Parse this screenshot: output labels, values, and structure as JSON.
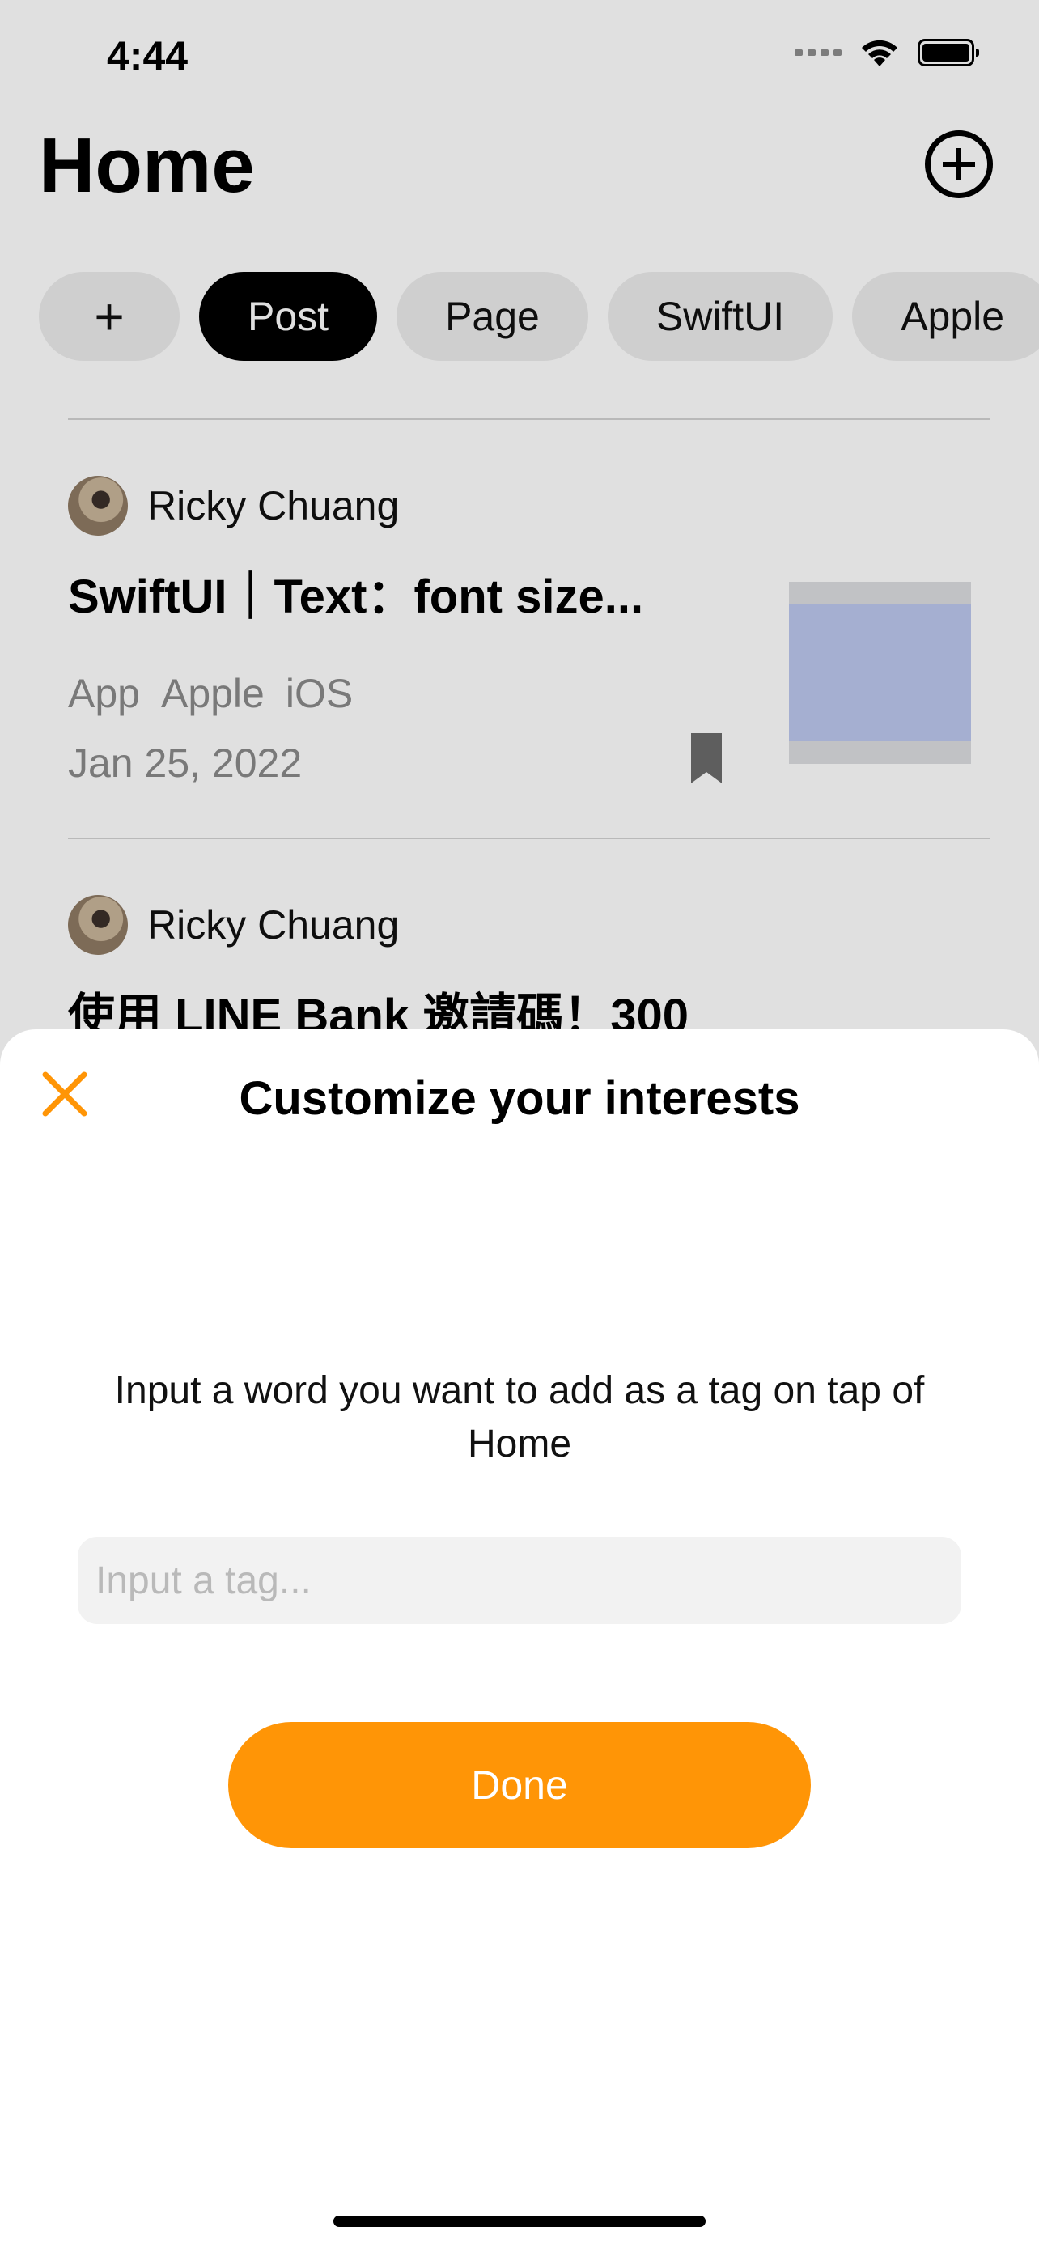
{
  "status_bar": {
    "time": "4:44"
  },
  "header": {
    "title": "Home",
    "add_icon": "plus-circle-icon"
  },
  "tags": {
    "add_label": "+",
    "items": [
      "Post",
      "Page",
      "SwiftUI",
      "Apple"
    ],
    "active": "Post"
  },
  "posts": [
    {
      "author": "Ricky Chuang",
      "title": "SwiftUI｜Text：font size...",
      "tags": [
        "App",
        "Apple",
        "iOS"
      ],
      "date": "Jan 25, 2022",
      "bookmark_icon": "bookmark-icon"
    },
    {
      "author": "Ricky Chuang",
      "title": "使用 LINE Bank 邀請碼！300"
    }
  ],
  "sheet": {
    "title": "Customize your interests",
    "close_icon": "close-icon",
    "message": "Input a word you want to add as a tag on tap of Home",
    "input_placeholder": "Input a tag...",
    "input_value": "",
    "done_label": "Done",
    "accent_color": "#FF9506"
  }
}
